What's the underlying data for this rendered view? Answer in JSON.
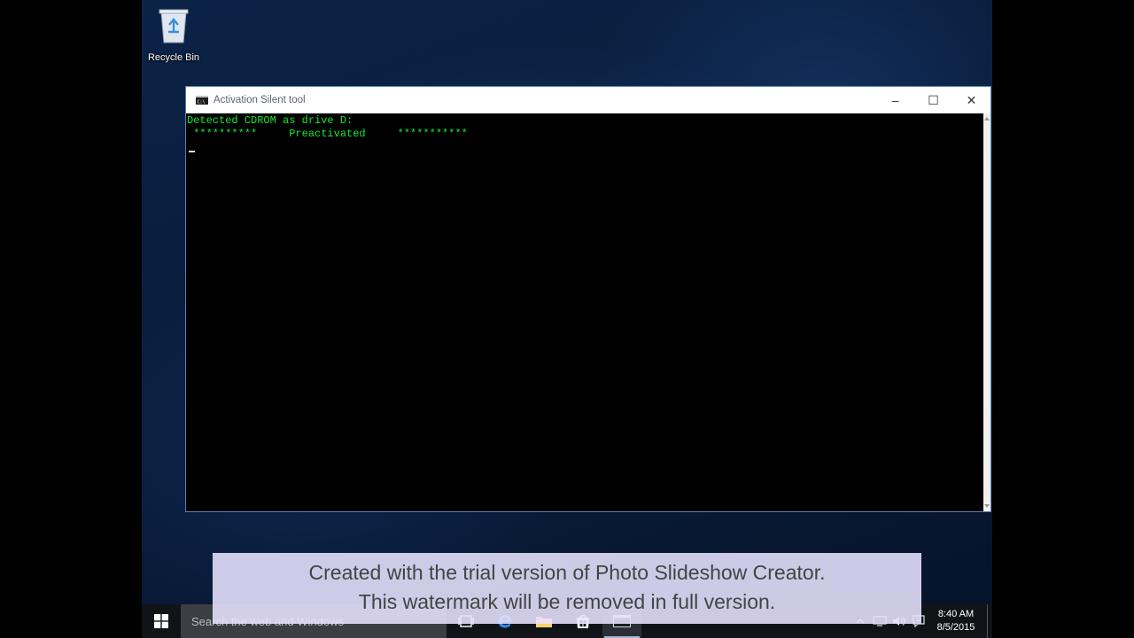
{
  "desktop": {
    "recycle_bin_label": "Recycle Bin"
  },
  "window": {
    "title": "Activation Silent tool",
    "controls": {
      "minimize": "–",
      "maximize": "☐",
      "close": "✕"
    },
    "console_lines": [
      "Detected CDROM as drive D:",
      " **********     Preactivated     ***********"
    ]
  },
  "watermark": {
    "line1": "Created with the trial version of Photo Slideshow Creator.",
    "line2": "This watermark will be removed in full version."
  },
  "taskbar": {
    "search_placeholder": "Search the web and Windows",
    "clock_time": "8:40 AM",
    "clock_date": "8/5/2015"
  },
  "colors": {
    "console_text": "#14e82e",
    "console_bg": "#000000",
    "taskbar_bg": "#101418"
  }
}
